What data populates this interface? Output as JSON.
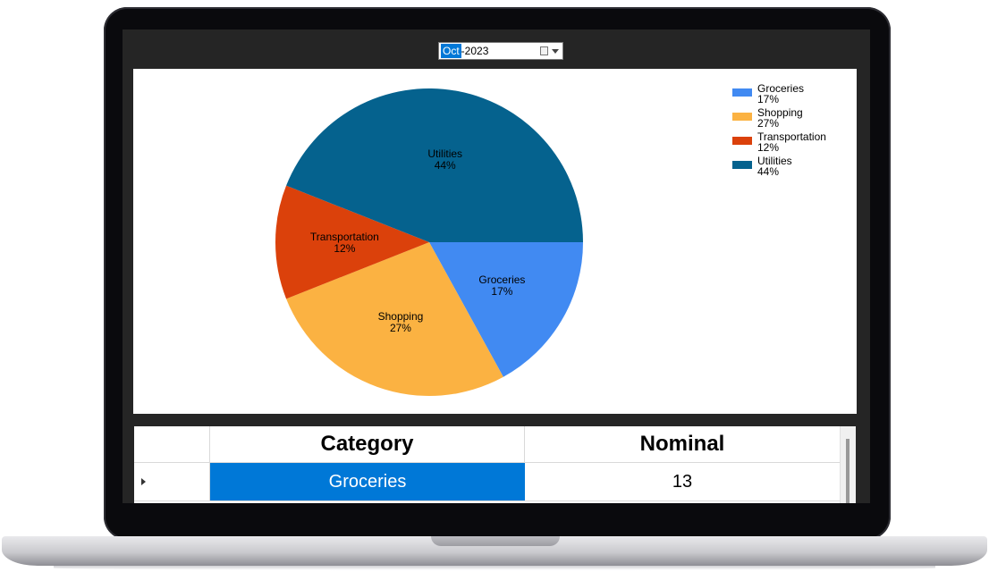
{
  "datepicker": {
    "month": "Oct",
    "rest": "-2023"
  },
  "chart_data": {
    "type": "pie",
    "start_angle_deg": 0,
    "direction": "clockwise",
    "slices": [
      {
        "label": "Groceries",
        "percent_label": "17%",
        "value": 17,
        "color": "#418af2"
      },
      {
        "label": "Shopping",
        "percent_label": "27%",
        "value": 27,
        "color": "#fbb242"
      },
      {
        "label": "Transportation",
        "percent_label": "12%",
        "value": 12,
        "color": "#db410b"
      },
      {
        "label": "Utilities",
        "percent_label": "44%",
        "value": 44,
        "color": "#05628e"
      }
    ],
    "legend_position": "top-right"
  },
  "grid": {
    "columns": [
      "Category",
      "Nominal"
    ],
    "rows": [
      {
        "category": "Groceries",
        "nominal": "13"
      }
    ]
  }
}
